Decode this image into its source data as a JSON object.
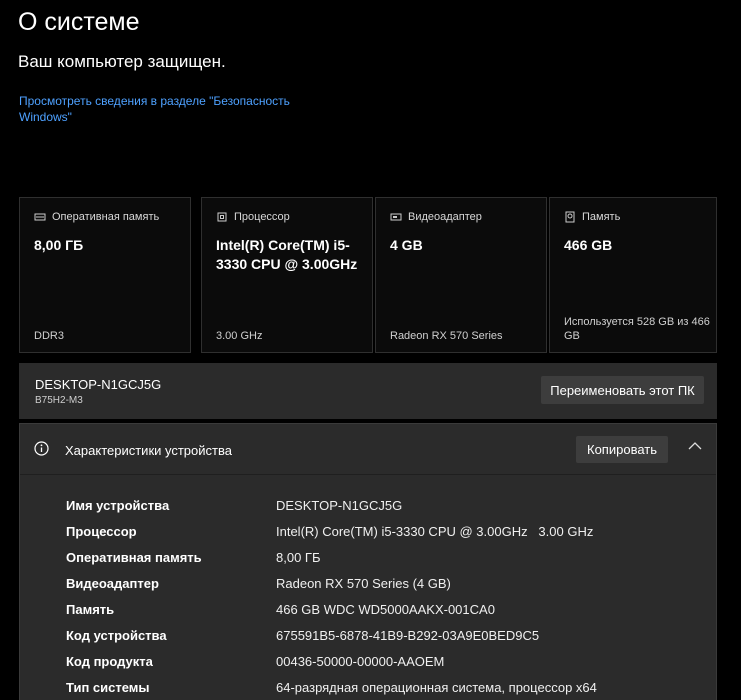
{
  "page": {
    "title": "О системе",
    "protected_text": "Ваш компьютер защищен.",
    "security_link": "Просмотреть сведения в разделе \"Безопасность Windows\""
  },
  "cards": [
    {
      "icon": "ram-icon",
      "label": "Оперативная память",
      "value": "8,00 ГБ",
      "footer": "DDR3"
    },
    {
      "icon": "cpu-icon",
      "label": "Процессор",
      "value": "Intel(R) Core(TM) i5-3330 CPU @ 3.00GHz",
      "footer": "3.00 GHz"
    },
    {
      "icon": "gpu-icon",
      "label": "Видеоадаптер",
      "value": "4 GB",
      "footer": "Radeon RX 570 Series"
    },
    {
      "icon": "storage-icon",
      "label": "Память",
      "value": "466 GB",
      "footer": "Используется 528 GB из 466 GB"
    }
  ],
  "pc": {
    "name": "DESKTOP-N1GCJ5G",
    "model": "B75H2-M3",
    "rename_label": "Переименовать этот ПК"
  },
  "specs": {
    "header_label": "Характеристики устройства",
    "copy_label": "Копировать",
    "rows": [
      {
        "k": "Имя устройства",
        "v": "DESKTOP-N1GCJ5G"
      },
      {
        "k": "Процессор",
        "v": "Intel(R) Core(TM) i5-3330 CPU @ 3.00GHz   3.00 GHz"
      },
      {
        "k": "Оперативная память",
        "v": "8,00 ГБ"
      },
      {
        "k": "Видеоадаптер",
        "v": "Radeon RX 570 Series (4 GB)"
      },
      {
        "k": "Память",
        "v": "466 GB WDC WD5000AAKX-001CA0"
      },
      {
        "k": "Код устройства",
        "v": "675591B5-6878-41B9-B292-03A9E0BED9C5"
      },
      {
        "k": "Код продукта",
        "v": "00436-50000-00000-AAOEM"
      },
      {
        "k": "Тип системы",
        "v": "64-разрядная операционная система, процессор x64"
      }
    ]
  }
}
